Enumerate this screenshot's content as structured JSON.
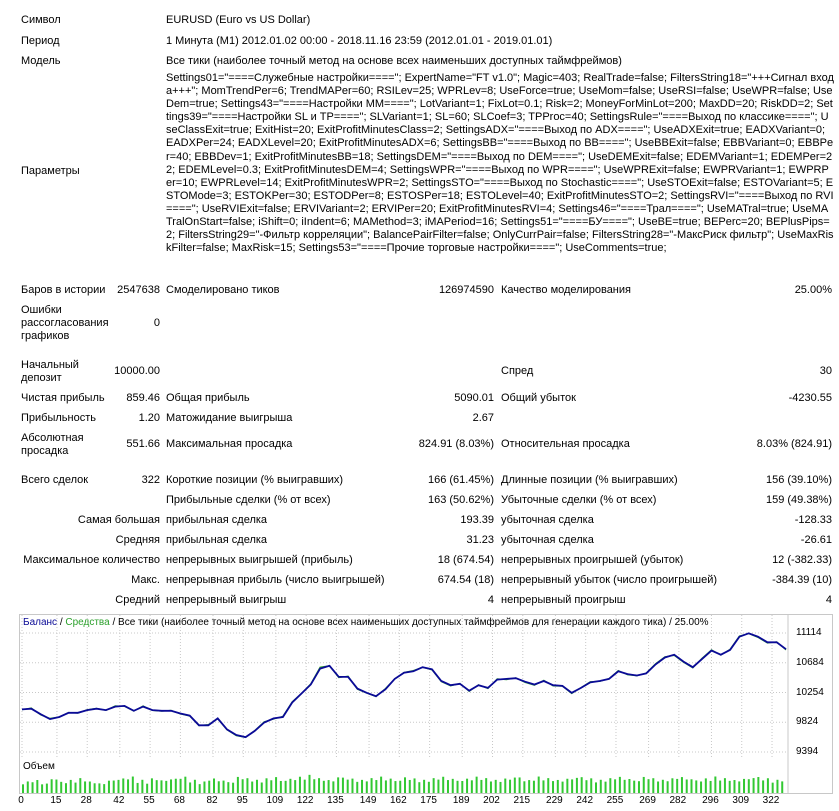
{
  "info": [
    {
      "label": "Символ",
      "value": "EURUSD (Euro vs US Dollar)"
    },
    {
      "label": "Период",
      "value": "1 Минута (M1) 2012.01.02 00:00 - 2018.11.16 23:59 (2012.01.01 - 2019.01.01)"
    },
    {
      "label": "Модель",
      "value": "Все тики (наиболее точный метод на основе всех наименьших доступных таймфреймов)"
    },
    {
      "label": "Параметры",
      "value": ""
    }
  ],
  "parameters": "Settings01=\"====Служебные настройки====\"; ExpertName=\"FT v1.0\"; Magic=403; RealTrade=false; FiltersString18=\"+++Сигнал входа+++\"; MomTrendPer=6; TrendMAPer=60; RSILev=25; WPRLev=8; UseForce=true; UseMom=false; UseRSI=false; UseWPR=false; UseDem=true; Settings43=\"====Настройки MM====\"; LotVariant=1; FixLot=0.1; Risk=2; MoneyForMinLot=200; MaxDD=20; RiskDD=2; Settings39=\"====Настройки SL и TP====\"; SLVariant=1; SL=60; SLCoef=3; TPProc=40; SettingsRule=\"====Выход по классике====\"; UseClassExit=true; ExitHist=20; ExitProfitMinutesClass=2; SettingsADX=\"====Выход по ADX====\"; UseADXExit=true; EADXVariant=0; EADXPer=24; EADXLevel=20; ExitProfitMinutesADX=6; SettingsBB=\"====Выход по BB====\"; UseBBExit=false; EBBVariant=0; EBBPer=40; EBBDev=1; ExitProfitMinutesBB=18; SettingsDEM=\"====Выход по DEM====\"; UseDEMExit=false; EDEMVariant=1; EDEMPer=22; EDEMLevel=0.3; ExitProfitMinutesDEM=4; SettingsWPR=\"====Выход по WPR====\"; UseWPRExit=false; EWPRVariant=1; EWPRPer=10; EWPRLevel=14; ExitProfitMinutesWPR=2; SettingsSTO=\"====Выход по Stochastic====\"; UseSTOExit=false; ESTOVariant=5; ESTOMode=3; ESTOKPer=30; ESTODPer=8; ESTOSPer=18; ESTOLevel=40; ExitProfitMinutesSTO=2; SettingsRVI=\"====Выход по RVI====\"; UseRVIExit=false; ERVIVariant=2; ERVIPer=20; ExitProfitMinutesRVI=4; Settings46=\"====Трал====\"; UseMATral=true; UseMATralOnStart=false; iShift=0; iIndent=6; MAMethod=3; iMAPeriod=16; Settings51=\"====БУ====\"; UseBE=true; BEPerc=20; BEPlusPips=2; FiltersString29=\"-Фильтр корреляции\"; BalancePairFilter=false; OnlyCurrPair=false; FiltersString28=\"-МаксРиск фильтр\"; UseMaxRiskFilter=false; MaxRisk=15; Settings53=\"====Прочие торговые настройки====\"; UseComments=true;",
  "stats": {
    "bars_label": "Баров в истории",
    "bars": "2547638",
    "ticks_label": "Смоделировано тиков",
    "ticks": "126974590",
    "quality_label": "Качество моделирования",
    "quality": "25.00%",
    "errors_label": "Ошибки рассогласования графиков",
    "errors": "0",
    "deposit_label": "Начальный депозит",
    "deposit": "10000.00",
    "spread_label": "Спред",
    "spread": "30",
    "netprofit_label": "Чистая прибыль",
    "netprofit": "859.46",
    "grossprofit_label": "Общая прибыль",
    "grossprofit": "5090.01",
    "grossloss_label": "Общий убыток",
    "grossloss": "-4230.55",
    "pf_label": "Прибыльность",
    "pf": "1.20",
    "expected_label": "Матожидание выигрыша",
    "expected": "2.67",
    "absdd_label": "Абсолютная просадка",
    "absdd": "551.66",
    "maxdd_label": "Максимальная просадка",
    "maxdd": "824.91 (8.03%)",
    "reldd_label": "Относительная просадка",
    "reldd": "8.03% (824.91)",
    "trades_label": "Всего сделок",
    "trades": "322",
    "short_label": "Короткие позиции (% выигравших)",
    "short": "166 (61.45%)",
    "long_label": "Длинные позиции (% выигравших)",
    "long": "156 (39.10%)",
    "wintrades_label": "Прибыльные сделки (% от всех)",
    "wintrades": "163 (50.62%)",
    "losstrades_label": "Убыточные сделки (% от всех)",
    "losstrades": "159 (49.38%)",
    "largest_label": "Самая большая",
    "largest_win_label": "прибыльная сделка",
    "largest_win": "193.39",
    "largest_loss_label": "убыточная сделка",
    "largest_loss": "-128.33",
    "average_label": "Средняя",
    "avg_win_label": "прибыльная сделка",
    "avg_win": "31.23",
    "avg_loss_label": "убыточная сделка",
    "avg_loss": "-26.61",
    "maxcons_label": "Максимальное количество",
    "maxcons_win_label": "непрерывных выигрышей (прибыль)",
    "maxcons_win": "18 (674.54)",
    "maxcons_loss_label": "непрерывных проигрышей (убыток)",
    "maxcons_loss": "12 (-382.33)",
    "maxconsp_label": "Макс.",
    "maxconsp_win_label": "непрерывная прибыль (число выигрышей)",
    "maxconsp_win": "674.54 (18)",
    "maxconsp_loss_label": "непрерывный убыток (число проигрышей)",
    "maxconsp_loss": "-384.39 (10)",
    "avgcons_label": "Средний",
    "avgcons_win_label": "непрерывный выигрыш",
    "avgcons_win": "4",
    "avgcons_loss_label": "непрерывный проигрыш",
    "avgcons_loss": "4"
  },
  "chart_legend": {
    "balance": "Баланс",
    "sep1": " / ",
    "equity": "Средства",
    "rest": " / Все тики (наиболее точный метод на основе всех наименьших доступных таймфреймов для генерации каждого тика) / 25.00%"
  },
  "volume_label": "Объем",
  "colors": {
    "balance": "#0a0a96",
    "equity": "#2ca02c",
    "volume": "#32c832",
    "grid": "#c8c8c8"
  },
  "chart_data": {
    "type": "line",
    "series": [
      {
        "name": "Баланс"
      },
      {
        "name": "Средства"
      }
    ],
    "y_ticks": [
      11114,
      10684,
      10254,
      9824,
      9394
    ],
    "ylim": [
      9394,
      11114
    ],
    "x_ticks": [
      0,
      15,
      28,
      42,
      55,
      68,
      82,
      95,
      109,
      122,
      135,
      149,
      162,
      175,
      189,
      202,
      215,
      229,
      242,
      255,
      269,
      282,
      296,
      309,
      322
    ],
    "xlim": [
      0,
      328
    ],
    "x": [
      0,
      4,
      8,
      12,
      16,
      20,
      24,
      28,
      32,
      36,
      40,
      44,
      48,
      52,
      56,
      60,
      64,
      68,
      72,
      76,
      80,
      84,
      88,
      92,
      96,
      100,
      104,
      108,
      112,
      116,
      120,
      124,
      128,
      132,
      136,
      140,
      144,
      148,
      152,
      156,
      160,
      164,
      168,
      172,
      176,
      180,
      184,
      188,
      192,
      196,
      200,
      204,
      208,
      212,
      216,
      220,
      224,
      228,
      232,
      236,
      240,
      244,
      248,
      252,
      256,
      260,
      264,
      268,
      272,
      276,
      280,
      284,
      288,
      292,
      296,
      300,
      304,
      308,
      312,
      316,
      320,
      324,
      328
    ],
    "balance": [
      10010,
      10020,
      9940,
      9870,
      9900,
      9960,
      9960,
      10000,
      10020,
      10000,
      10050,
      10060,
      9990,
      10050,
      10000,
      9990,
      9990,
      9950,
      9920,
      9780,
      9780,
      9880,
      9720,
      9640,
      9610,
      9700,
      9820,
      9880,
      9900,
      10110,
      10240,
      10370,
      10600,
      10640,
      10480,
      10480,
      10310,
      10250,
      10200,
      10300,
      10450,
      10540,
      10560,
      10620,
      10590,
      10420,
      10360,
      10380,
      10280,
      10360,
      10320,
      10440,
      10450,
      10460,
      10410,
      10370,
      10420,
      10360,
      10350,
      10250,
      10320,
      10400,
      10420,
      10450,
      10560,
      10520,
      10500,
      10530,
      10660,
      10760,
      10800,
      10700,
      10620,
      10740,
      10860,
      10800,
      10870,
      11060,
      11110,
      11060,
      10980,
      10980,
      10880
    ],
    "equity": [
      10005,
      10030,
      9930,
      9880,
      9900,
      9965,
      9955,
      10005,
      10025,
      9995,
      10060,
      10055,
      9985,
      10060,
      9995,
      9985,
      9995,
      9945,
      9915,
      9775,
      9790,
      9875,
      9715,
      9630,
      9605,
      9705,
      9830,
      9870,
      9910,
      10120,
      10240,
      10380,
      10620,
      10640,
      10470,
      10490,
      10300,
      10245,
      10195,
      10310,
      10450,
      10545,
      10570,
      10620,
      10580,
      10410,
      10350,
      10385,
      10270,
      10365,
      10310,
      10450,
      10440,
      10465,
      10400,
      10360,
      10430,
      10350,
      10345,
      10240,
      10325,
      10410,
      10415,
      10455,
      10570,
      10510,
      10495,
      10535,
      10670,
      10770,
      10790,
      10690,
      10610,
      10750,
      10870,
      10795,
      10880,
      11070,
      11105,
      11050,
      10970,
      10985,
      10870
    ],
    "volume": [
      7,
      8,
      6,
      9,
      7,
      8,
      9,
      7,
      6,
      8,
      9,
      10,
      8,
      7,
      9,
      8,
      9,
      10,
      8,
      7,
      9,
      8,
      7,
      10,
      9,
      8,
      9,
      10,
      8,
      9,
      10,
      11,
      9,
      8,
      10,
      9,
      8,
      9,
      10,
      9,
      8,
      10,
      9,
      8,
      9,
      10,
      9,
      8,
      9,
      10,
      9,
      8,
      9,
      10,
      8,
      9,
      10,
      9,
      8,
      9,
      10,
      9,
      8,
      9,
      10,
      9,
      8,
      10,
      9,
      8,
      9,
      10,
      9,
      8,
      9,
      10,
      9,
      8,
      9,
      10,
      9,
      8,
      9
    ]
  }
}
